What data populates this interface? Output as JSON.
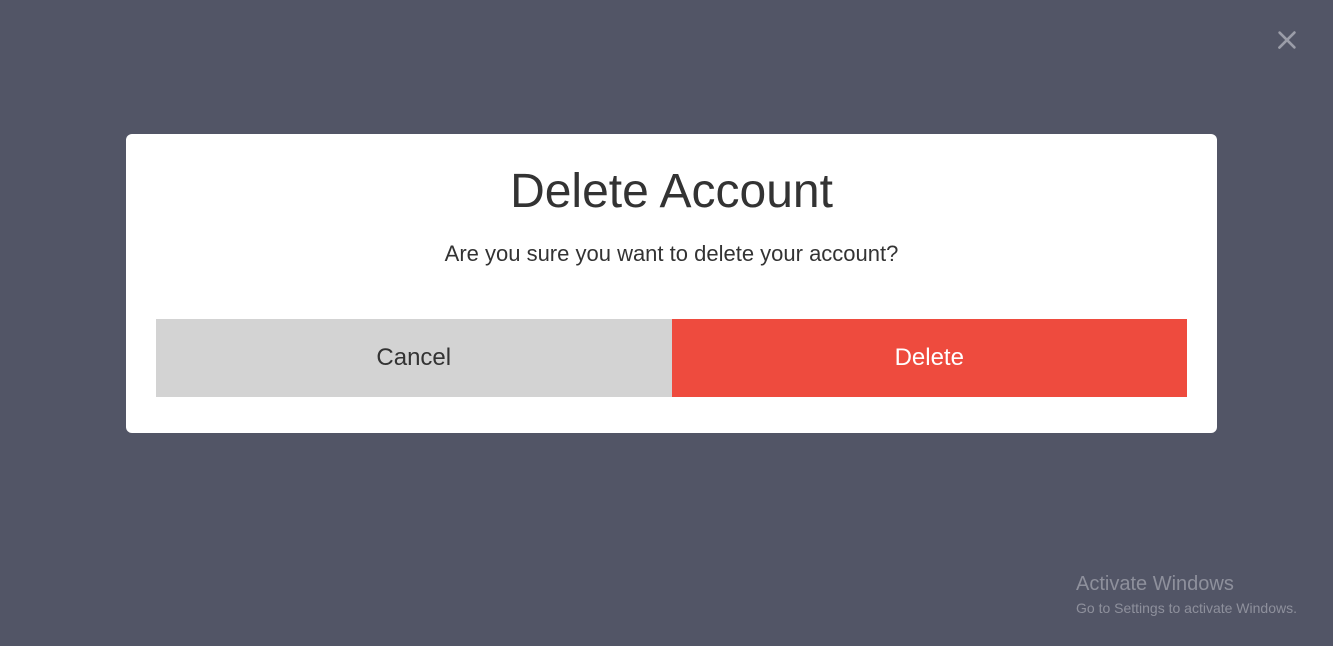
{
  "modal": {
    "title": "Delete Account",
    "message": "Are you sure you want to delete your account?",
    "cancel_label": "Cancel",
    "delete_label": "Delete"
  },
  "watermark": {
    "title": "Activate Windows",
    "subtitle": "Go to Settings to activate Windows."
  }
}
